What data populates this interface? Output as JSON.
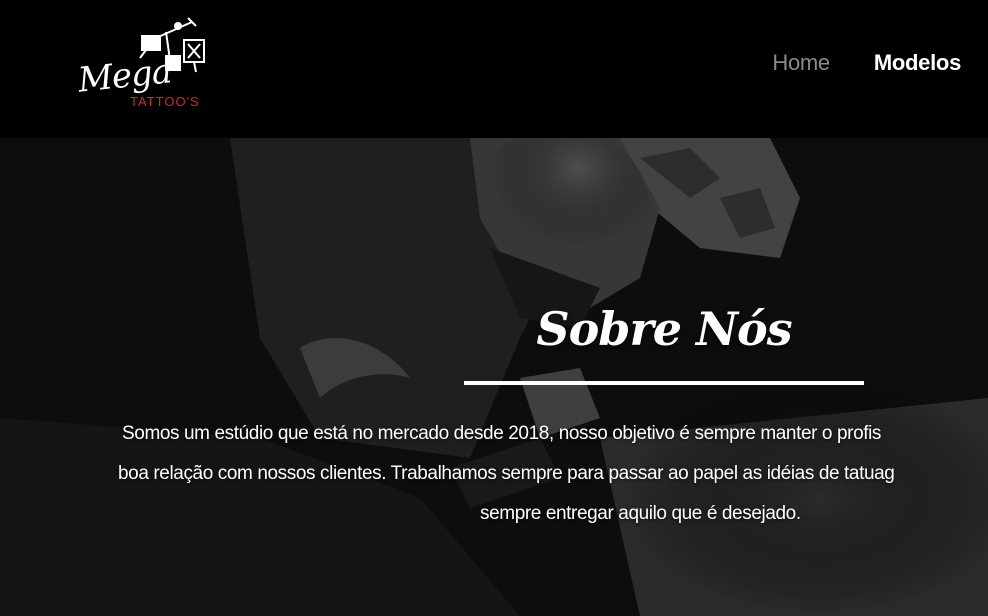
{
  "brand": {
    "script": "Mega",
    "sub": "TATTOO'S",
    "accent_color": "#d42a2a",
    "icon": "tattoo-machine-icon"
  },
  "nav": {
    "items": [
      {
        "label": "Home",
        "active": false
      },
      {
        "label": "Modelos",
        "active": true
      }
    ]
  },
  "hero": {
    "title": "Sobre Nós",
    "lines": [
      "Somos um estúdio que está no mercado desde 2018, nosso objetivo é sempre manter o profis",
      "boa relação com nossos clientes. Trabalhamos sempre para passar ao papel as idéias de tatuag",
      "sempre entregar aquilo que é desejado."
    ]
  }
}
